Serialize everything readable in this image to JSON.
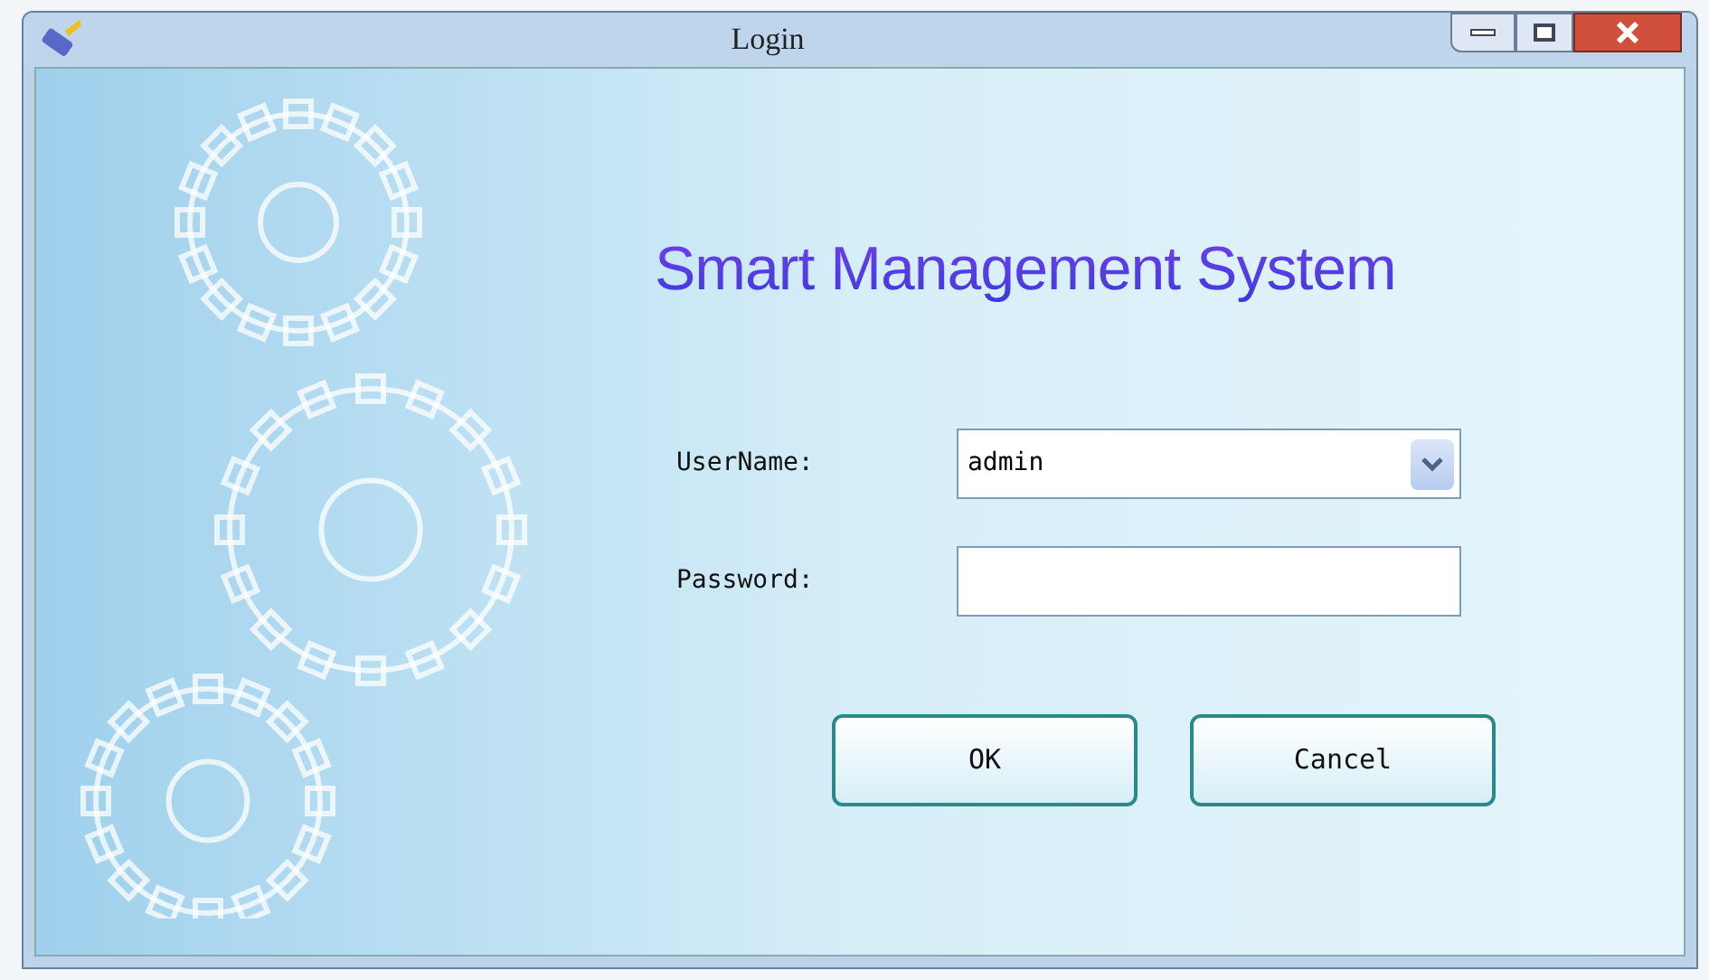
{
  "window": {
    "title": "Login"
  },
  "heading": "Smart Management System",
  "fields": [
    {
      "kind": "dropdown",
      "label": "UserName:",
      "value": "admin"
    },
    {
      "kind": "password",
      "label": "Password:"
    }
  ],
  "buttons": [
    "OK",
    "Cancel"
  ]
}
